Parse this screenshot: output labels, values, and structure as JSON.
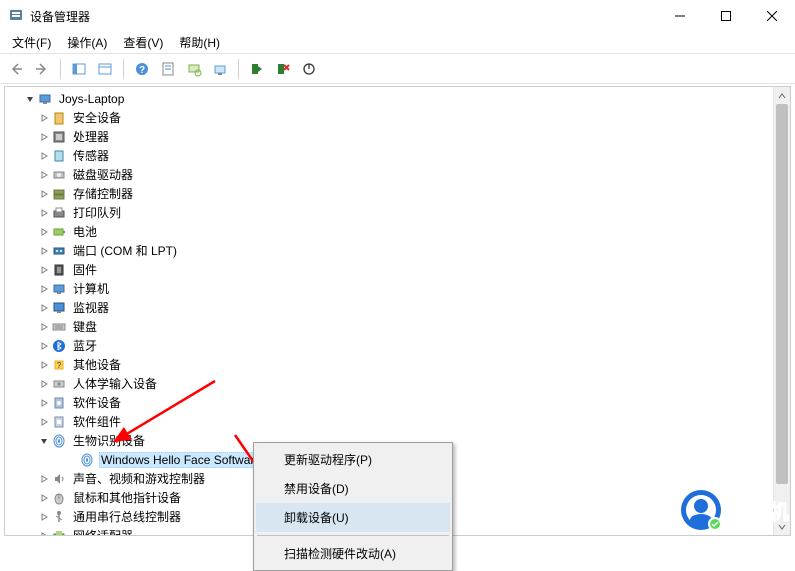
{
  "window": {
    "title": "设备管理器",
    "minimize": "—",
    "maximize": "☐",
    "close": "✕"
  },
  "menu": {
    "file": "文件(F)",
    "action": "操作(A)",
    "view": "查看(V)",
    "help": "帮助(H)"
  },
  "tree": {
    "root": "Joys-Laptop",
    "items": [
      {
        "label": "安全设备",
        "icon": "security"
      },
      {
        "label": "处理器",
        "icon": "cpu"
      },
      {
        "label": "传感器",
        "icon": "sensor"
      },
      {
        "label": "磁盘驱动器",
        "icon": "disk"
      },
      {
        "label": "存储控制器",
        "icon": "storage"
      },
      {
        "label": "打印队列",
        "icon": "printer"
      },
      {
        "label": "电池",
        "icon": "battery"
      },
      {
        "label": "端口 (COM 和 LPT)",
        "icon": "port"
      },
      {
        "label": "固件",
        "icon": "firmware"
      },
      {
        "label": "计算机",
        "icon": "computer"
      },
      {
        "label": "监视器",
        "icon": "monitor"
      },
      {
        "label": "键盘",
        "icon": "keyboard"
      },
      {
        "label": "蓝牙",
        "icon": "bluetooth"
      },
      {
        "label": "其他设备",
        "icon": "other"
      },
      {
        "label": "人体学输入设备",
        "icon": "hid"
      },
      {
        "label": "软件设备",
        "icon": "software"
      },
      {
        "label": "软件组件",
        "icon": "software2"
      },
      {
        "label": "生物识别设备",
        "icon": "biometric",
        "expanded": true,
        "children": [
          {
            "label": "Windows Hello Face Softwar",
            "selected": true
          }
        ]
      },
      {
        "label": "声音、视频和游戏控制器",
        "icon": "sound"
      },
      {
        "label": "鼠标和其他指针设备",
        "icon": "mouse"
      },
      {
        "label": "通用串行总线控制器",
        "icon": "usb"
      },
      {
        "label": "网络适配器",
        "icon": "network"
      }
    ]
  },
  "context_menu": {
    "update_driver": "更新驱动程序(P)",
    "disable": "禁用设备(D)",
    "uninstall": "卸载设备(U)",
    "scan": "扫描检测硬件改动(A)"
  },
  "watermark": {
    "text": "好装机"
  },
  "colors": {
    "selection": "#cce8ff",
    "arrow": "#ff0000",
    "watermark_blue": "#1e6fd9"
  }
}
